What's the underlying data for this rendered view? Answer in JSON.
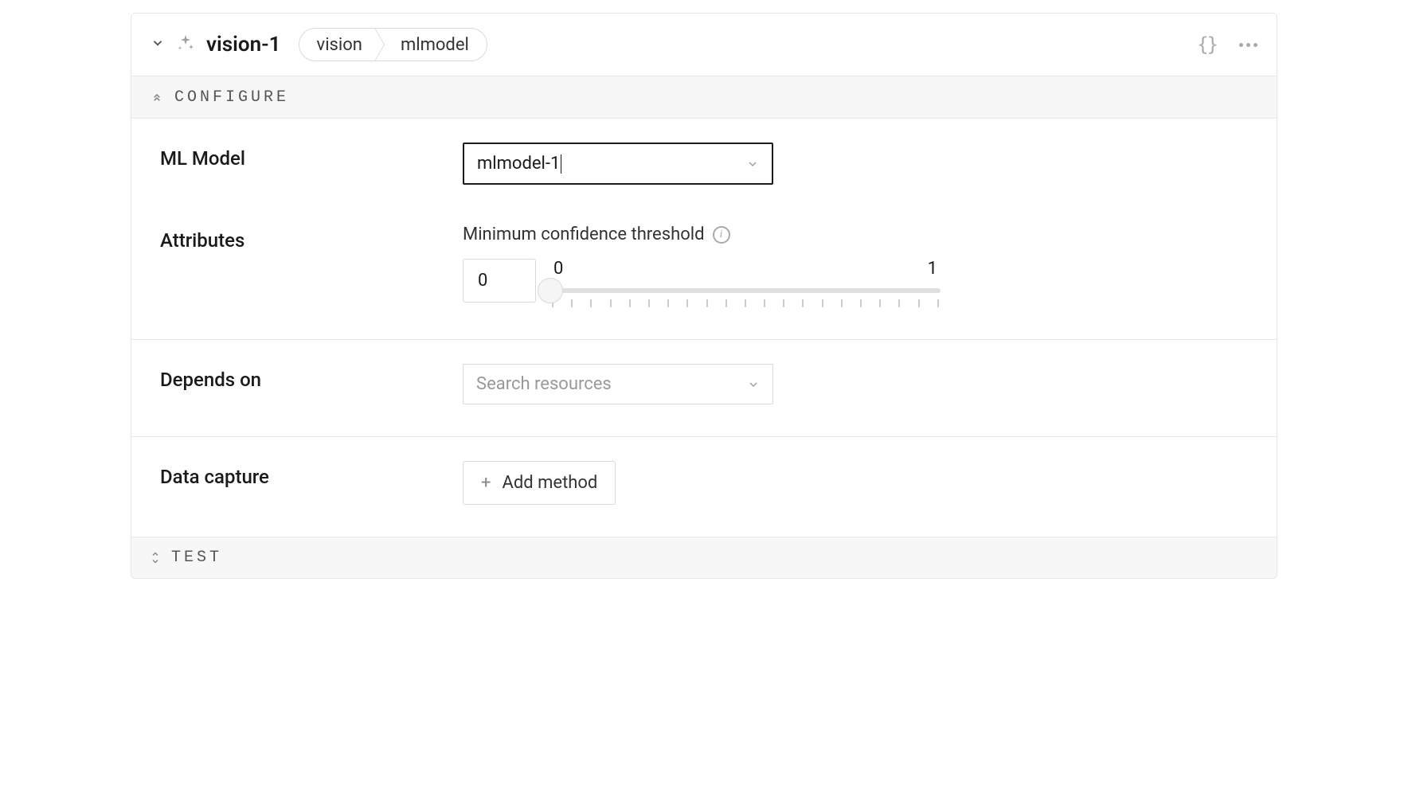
{
  "header": {
    "title": "vision-1",
    "breadcrumb": [
      "vision",
      "mlmodel"
    ]
  },
  "sections": {
    "configure": {
      "title": "CONFIGURE",
      "fields": {
        "ml_model": {
          "label": "ML Model",
          "value": "mlmodel-1"
        },
        "attributes": {
          "label": "Attributes",
          "sub_label": "Minimum confidence threshold",
          "value": "0",
          "range_min": "0",
          "range_max": "1"
        },
        "depends_on": {
          "label": "Depends on",
          "placeholder": "Search resources"
        },
        "data_capture": {
          "label": "Data capture",
          "button": "Add method"
        }
      }
    },
    "test": {
      "title": "TEST"
    }
  }
}
